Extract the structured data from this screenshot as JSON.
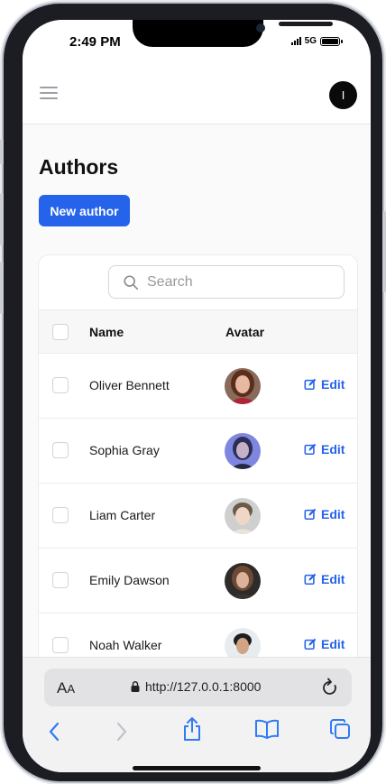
{
  "status": {
    "time": "2:49 PM",
    "network": "5G"
  },
  "header": {
    "user_initial": "I"
  },
  "page": {
    "title": "Authors",
    "new_button": "New author"
  },
  "search": {
    "placeholder": "Search",
    "value": ""
  },
  "table": {
    "columns": {
      "name": "Name",
      "avatar": "Avatar"
    },
    "edit_label": "Edit",
    "rows": [
      {
        "name": "Oliver Bennett"
      },
      {
        "name": "Sophia Gray"
      },
      {
        "name": "Liam Carter"
      },
      {
        "name": "Emily Dawson"
      },
      {
        "name": "Noah Walker"
      }
    ]
  },
  "browser": {
    "aa_big": "A",
    "aa_small": "A",
    "url": "http://127.0.0.1:8000"
  },
  "colors": {
    "accent": "#2563eb"
  }
}
